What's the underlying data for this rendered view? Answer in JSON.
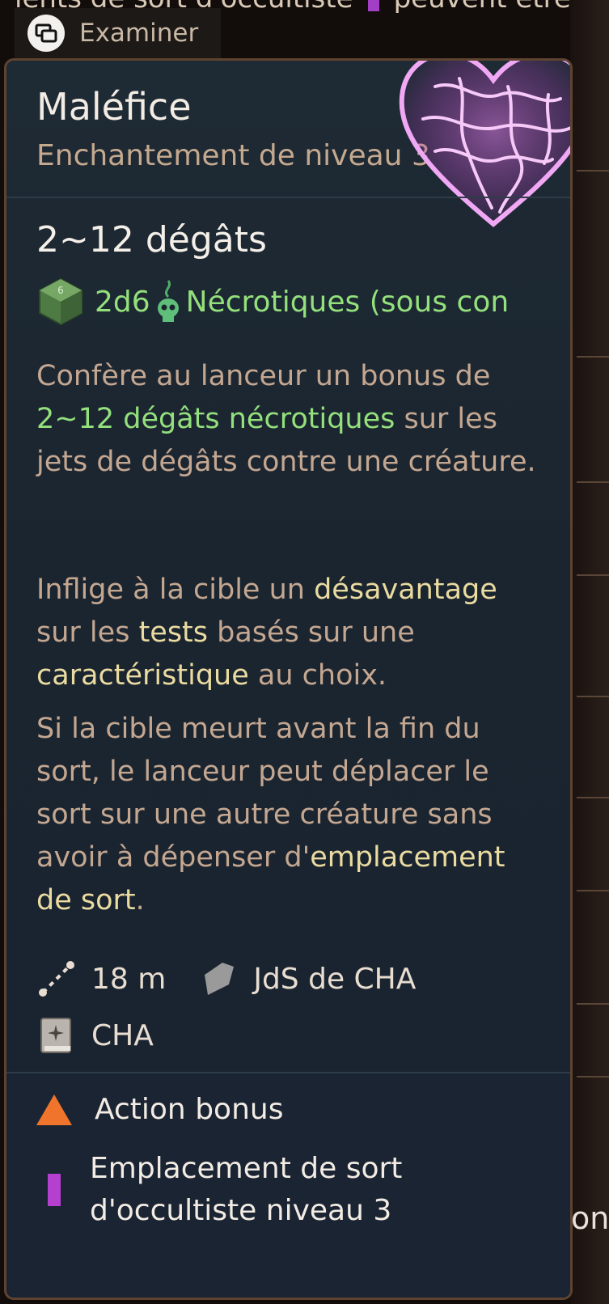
{
  "top_strip": {
    "text_left": "ients de sort d'occultiste",
    "text_right": "peuvent être"
  },
  "examine": {
    "label": "Examiner",
    "icon": "examine-icon"
  },
  "spell": {
    "name": "Maléfice",
    "subtitle": "Enchantement de niveau 3",
    "damage_title": "2~12 dégâts",
    "damage_roll": "2d6",
    "damage_type": "Nécrotiques (sous con",
    "desc1_a": "Confère au lanceur un bonus de",
    "desc1_b": "2~12 dégâts nécrotiques",
    "desc1_c": " sur les jets de dégâts contre une créature.",
    "desc2_a": "Inflige à la cible un ",
    "desc2_b": "désavantage",
    "desc2_c": " sur les ",
    "desc2_d": "tests",
    "desc2_e": " basés sur une ",
    "desc2_f": "caractéristique",
    "desc2_g": " au choix.",
    "desc3_a": "Si la cible meurt avant la fin du sort, le lanceur peut déplacer le sort sur une autre créature sans avoir à dépenser d'",
    "desc3_b": "emplacement de sort",
    "desc3_c": ".",
    "range": "18 m",
    "save": "JdS de CHA",
    "ability": "CHA"
  },
  "costs": {
    "action": "Action bonus",
    "slot_line1": "Emplacement de sort",
    "slot_line2": "d'occultiste niveau 3"
  },
  "side_fragment": "ont",
  "colors": {
    "accent_green": "#93e07c",
    "keyword_yellow": "#eadba0",
    "text_tan": "#c4a791",
    "action_orange": "#f0742c",
    "slot_purple": "#b540d0"
  }
}
